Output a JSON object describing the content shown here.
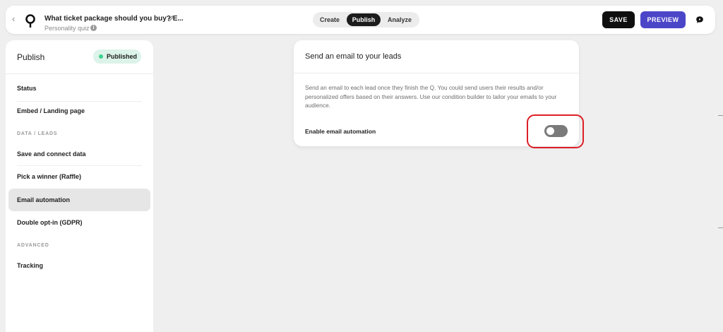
{
  "header": {
    "quiz_title": "What ticket package should you buy? E...",
    "quiz_type": "Personality quiz",
    "tabs": [
      {
        "label": "Create"
      },
      {
        "label": "Publish"
      },
      {
        "label": "Analyze"
      }
    ],
    "active_tab": "Publish",
    "save_label": "SAVE",
    "preview_label": "PREVIEW",
    "icons": [
      "back-arrow-icon",
      "logo-icon",
      "pencil-icon",
      "info-icon",
      "chat-icon"
    ]
  },
  "sidebar": {
    "title": "Publish",
    "status_badge": "Published",
    "items": [
      {
        "label": "Status"
      },
      {
        "label": "Embed / Landing page"
      },
      {
        "label": "Save and connect data"
      },
      {
        "label": "Pick a winner (Raffle)"
      },
      {
        "label": "Email automation"
      },
      {
        "label": "Double opt-in (GDPR)"
      },
      {
        "label": "Tracking"
      }
    ],
    "sections": {
      "data_leads": "DATA / LEADS",
      "advanced": "ADVANCED"
    },
    "active_item": "Email automation"
  },
  "card": {
    "title": "Send an email to your leads",
    "description": "Send an email to each lead once they finish the Q. You could send users their results and/or personalized offers based on their answers. Use our condition builder to tailor your emails to your audience.",
    "toggle_label": "Enable email automation",
    "toggle_on": false
  },
  "colors": {
    "accent": "#4b46c8",
    "status_green": "#3fcf8e",
    "highlight_red": "#dd1f26",
    "save_black": "#0f0f0f"
  }
}
